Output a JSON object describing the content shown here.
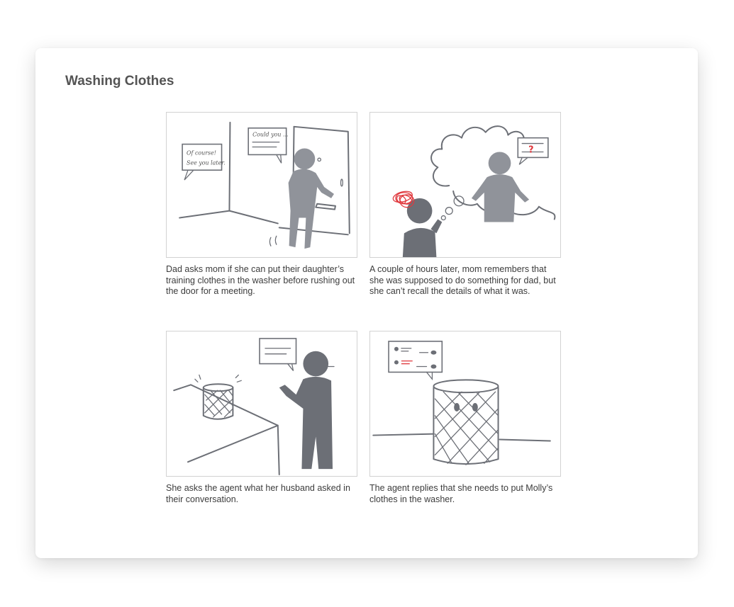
{
  "title": "Washing Clothes",
  "panels": [
    {
      "caption": "Dad asks mom if she can put their daughter’s training clothes in the washer before rushing out the door for a meeting.",
      "bubble_left_line1": "Of course!",
      "bubble_left_line2": "See you later.",
      "bubble_right": "Could you ..."
    },
    {
      "caption": "A couple of hours later, mom remembers that she was supposed to do something for dad, but she can’t recall the details of what it was.",
      "bubble_mark": "?"
    },
    {
      "caption": "She asks the agent what her husband asked in their conversation."
    },
    {
      "caption": "The agent replies that she needs to put Molly’s clothes in the washer."
    }
  ],
  "colors": {
    "figure_light": "#90939a",
    "figure_dark": "#6c6f76",
    "accent_red": "#e0393e"
  }
}
